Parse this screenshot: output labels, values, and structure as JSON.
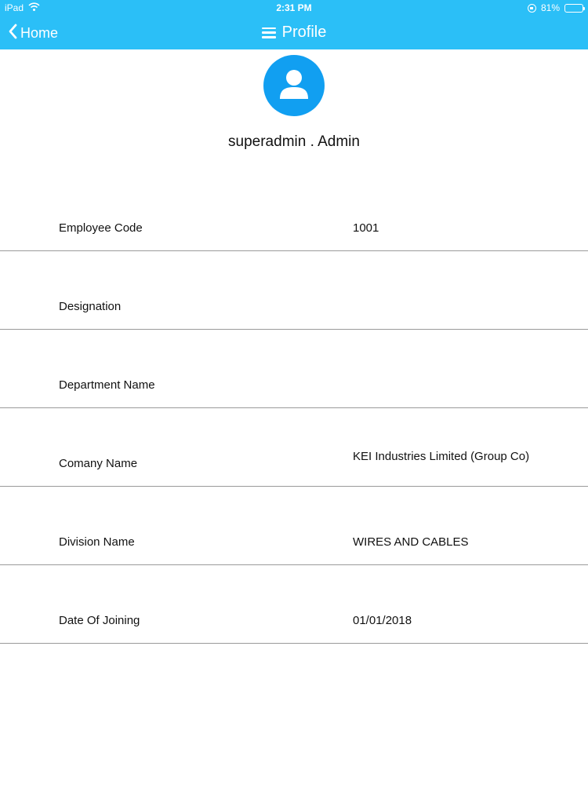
{
  "status_bar": {
    "device": "iPad",
    "time": "2:31 PM",
    "battery": "81%",
    "battery_level": 0.81
  },
  "nav": {
    "back_label": "Home",
    "title": "Profile"
  },
  "colors": {
    "nav_background": "#2bbff7",
    "avatar_background": "#119ff1",
    "divider": "#9a9a9a"
  },
  "profile": {
    "name": "superadmin . Admin"
  },
  "fields": [
    {
      "label": "Employee Code",
      "value": "1001"
    },
    {
      "label": "Designation",
      "value": ""
    },
    {
      "label": "Department Name",
      "value": ""
    },
    {
      "label": "Comany Name",
      "value": "KEI Industries Limited (Group Co)"
    },
    {
      "label": "Division Name",
      "value": "WIRES AND CABLES"
    },
    {
      "label": "Date Of Joining",
      "value": "01/01/2018"
    }
  ]
}
